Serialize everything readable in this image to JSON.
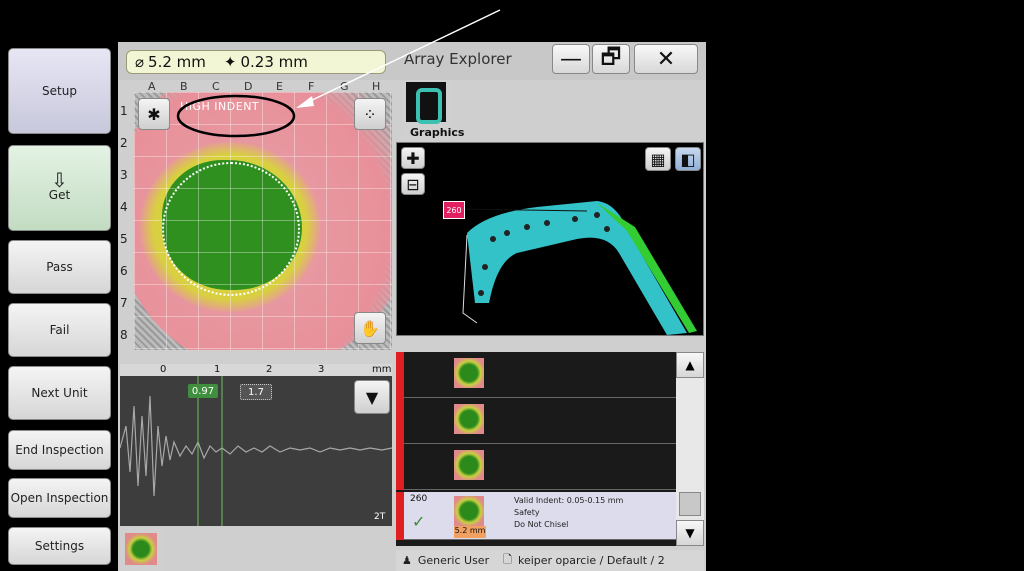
{
  "left_buttons": {
    "setup": "Setup",
    "get": "Get",
    "pass": "Pass",
    "fail": "Fail",
    "next_unit": "Next Unit",
    "end_inspection": "End Inspection",
    "open_inspection": "Open Inspection",
    "settings": "Settings"
  },
  "header": {
    "diameter": "5.2 mm",
    "depth": "0.23 mm",
    "title": "Array Explorer",
    "minimize": "—",
    "restore": "🗗",
    "close": "✕"
  },
  "heatmap": {
    "columns": [
      "A",
      "B",
      "C",
      "D",
      "E",
      "F",
      "G",
      "H"
    ],
    "rows": [
      "1",
      "2",
      "3",
      "4",
      "5",
      "6",
      "7",
      "8"
    ],
    "indent_label": "HIGH INDENT"
  },
  "waveform": {
    "ruler_ticks": [
      "0",
      "1",
      "2",
      "3",
      "mm"
    ],
    "gate_a": "0.97",
    "gate_b": "1.7",
    "scale_label": "2T"
  },
  "graphics": {
    "tab_label": "Graphics",
    "marker_label": "260"
  },
  "list": {
    "selected_row": {
      "id": "260",
      "check": "✓",
      "lines": [
        "Valid Indent: 0.05-0.15 mm",
        "Safety",
        "Do Not Chisel"
      ],
      "thumb_caption": "5.2 mm"
    }
  },
  "status": {
    "user": "Generic User",
    "path": "keiper oparcie / Default / 2"
  },
  "colors": {
    "accent_red": "#e02020",
    "readout_bg": "#f2f6d4",
    "heat_green": "#2f8f1f",
    "heat_pink": "#e6909a"
  }
}
